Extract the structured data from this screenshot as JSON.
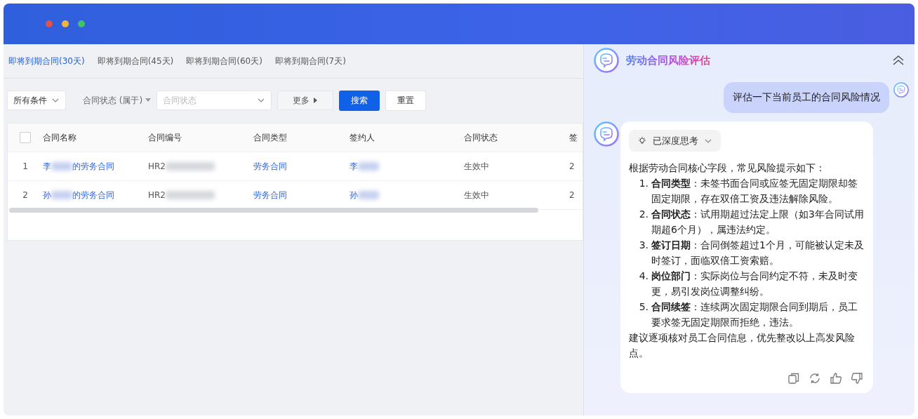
{
  "tabs": [
    {
      "label": "即将到期合同(30天)",
      "selected": true
    },
    {
      "label": "即将到期合同(45天)",
      "selected": false
    },
    {
      "label": "即将到期合同(60天)",
      "selected": false
    },
    {
      "label": "即将到期合同(7天)",
      "selected": false
    }
  ],
  "filters": {
    "condition_select": "所有条件",
    "field_label": "合同状态 (属于)",
    "status_placeholder": "合同状态",
    "more_button": "更多",
    "search_button": "搜索",
    "reset_button": "重置"
  },
  "table": {
    "header_checked": false,
    "columns": [
      "合同名称",
      "合同编号",
      "合同类型",
      "签约人",
      "合同状态",
      "签"
    ],
    "rows": [
      {
        "index": "1",
        "name_prefix": "李",
        "name_suffix": "的劳务合同",
        "number_prefix": "HR2",
        "type": "劳务合同",
        "signer_prefix": "李",
        "status": "生效中",
        "column_7": "2"
      },
      {
        "index": "2",
        "name_prefix": "孙",
        "name_suffix": "的劳务合同",
        "number_prefix": "HR2",
        "type": "劳务合同",
        "signer_prefix": "孙",
        "status": "生效中",
        "column_7": "2"
      }
    ]
  },
  "chat": {
    "title": "劳动合同风险评估",
    "user_message": "评估一下当前员工的合同风险情况",
    "thinking_label": "已深度思考",
    "intro": "根据劳动合同核心字段，常见风险提示如下：",
    "items": [
      {
        "marker": "1.",
        "term": "合同类型",
        "text": "：未签书面合同或应签无固定期限却签固定期限，存在双倍工资及违法解除风险。"
      },
      {
        "marker": "2.",
        "term": "合同状态",
        "text": "：试用期超过法定上限（如3年合同试用期超6个月），属违法约定。"
      },
      {
        "marker": "3.",
        "term": "签订日期",
        "text": "：合同倒签超过1个月，可能被认定未及时签订，面临双倍工资索赔。"
      },
      {
        "marker": "4.",
        "term": "岗位部门",
        "text": "：实际岗位与合同约定不符，未及时变更，易引发岗位调整纠纷。"
      },
      {
        "marker": "5.",
        "term": "合同续签",
        "text": "：连续两次固定期限合同到期后，员工要求签无固定期限而拒绝，违法。"
      }
    ],
    "conclusion": "建议逐项核对员工合同信息，优先整改以上高发风险点。"
  }
}
